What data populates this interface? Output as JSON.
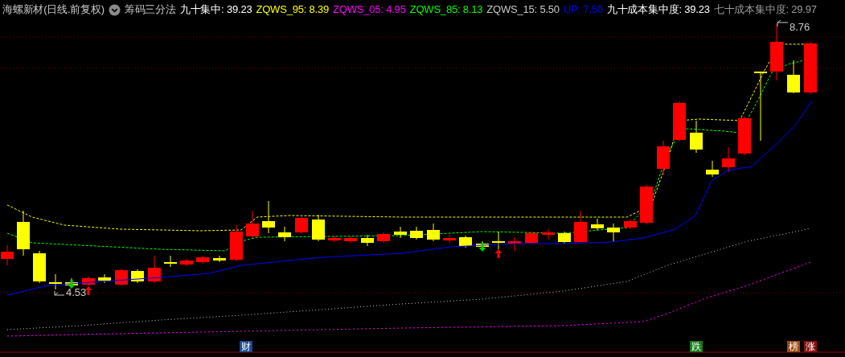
{
  "header": {
    "stock": "海螺新材(日线.前复权)",
    "indicator": "筹码三分法",
    "legend": [
      {
        "text": "九十集中: 39.23",
        "color": "#ffffff"
      },
      {
        "text": "ZQWS_95: 8.39",
        "color": "#ffff00"
      },
      {
        "text": "ZQWS_05: 4.95",
        "color": "#ff00ff"
      },
      {
        "text": "ZQWS_85: 8.13",
        "color": "#00ff00"
      },
      {
        "text": "ZQWS_15: 5.50",
        "color": "#c8c8c8"
      },
      {
        "text": "UP: 7.50",
        "color": "#0000ff"
      },
      {
        "text": "九十成本集中度: 39.23",
        "color": "#ffffff"
      },
      {
        "text": "七十成本集中度: 29.97",
        "color": "#9a9a9a"
      }
    ]
  },
  "chart": {
    "high_label": "8.76",
    "low_label": "4.53",
    "markers": [
      {
        "text": "财",
        "color": "#1e4a8c"
      },
      {
        "text": "跌",
        "color": "#1a7a1a"
      },
      {
        "text": "榜",
        "color": "#a04a10"
      },
      {
        "text": "涨",
        "color": "#8a1010"
      }
    ]
  }
}
